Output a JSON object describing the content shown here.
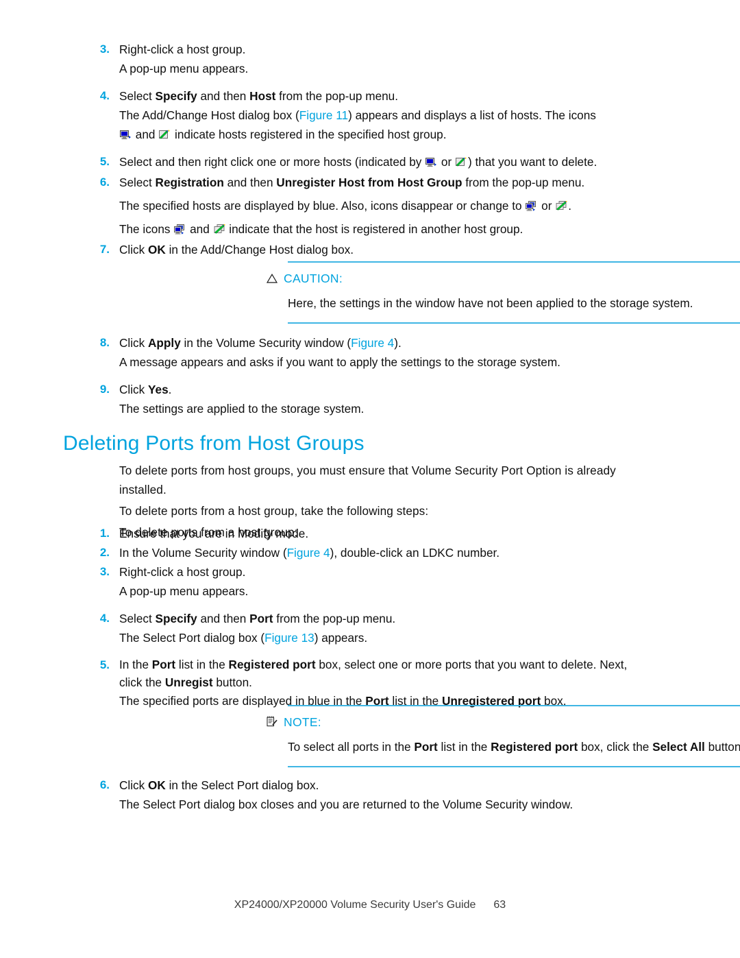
{
  "page": {
    "footer_title": "XP24000/XP20000 Volume Security User's Guide",
    "footer_page": "63"
  },
  "colors": {
    "accent_blue": "#00a3de",
    "rule_blue": "#3fb6e4",
    "body_text": "#101010"
  },
  "section_one": {
    "steps": [
      {
        "num": "3.",
        "line1_pre": "Right-click a host group.",
        "sub1": "A pop-up menu appears."
      },
      {
        "num": "4.",
        "line1_a": "Select ",
        "line1_b1": "Specify",
        "line1_c": " and then ",
        "line1_b2": "Host",
        "line1_d": " from the pop-up menu.",
        "sub1_a": "The Add/Change Host dialog box (",
        "sub1_fig": "Figure 11",
        "sub1_b": ") appears and displays a list of hosts. The icons",
        "sub2_a": " and ",
        "sub2_b": " indicate hosts registered in the specified host group."
      },
      {
        "num": "5.",
        "line1_a": "Select and then right click one or more hosts (indicated by ",
        "line1_b": " or ",
        "line1_c": ") that you want to delete."
      },
      {
        "num": "6.",
        "line1_a": "Select ",
        "line1_b1": "Registration",
        "line1_c": " and then ",
        "line1_b2": "Unregister Host from Host Group",
        "line1_d": " from the pop-up menu.",
        "sub1_a": "The specified hosts are displayed by blue. Also, icons disappear or change to ",
        "sub1_b": " or ",
        "sub1_c": ".",
        "sub2_a": "The icons ",
        "sub2_b": " and ",
        "sub2_c": " indicate that the host is registered in another host group."
      },
      {
        "num": "7.",
        "line1_a": "Click ",
        "line1_b": "OK",
        "line1_c": " in the Add/Change Host dialog box."
      }
    ],
    "caution": {
      "icon": "caution-triangle-icon",
      "label": "CAUTION:",
      "text": "Here, the settings in the window have not been applied to the storage system."
    },
    "steps_after": [
      {
        "num": "8.",
        "line1_a": "Click ",
        "line1_b": "Apply",
        "line1_c": " in the Volume Security window (",
        "line1_fig": "Figure 4",
        "line1_d": ").",
        "sub1": "A message appears and asks if you want to apply the settings to the storage system."
      },
      {
        "num": "9.",
        "line1_a": "Click ",
        "line1_b": "Yes",
        "line1_c": ".",
        "sub1": "The settings are applied to the storage system."
      }
    ]
  },
  "section_two": {
    "title": "Deleting Ports from Host Groups",
    "intro": [
      "To delete ports from host groups, you must ensure that Volume Security Port Option is already installed.",
      "To delete ports from a host group, take the following steps:",
      "To delete ports from a host group:"
    ],
    "steps": [
      {
        "num": "1.",
        "line1": "Ensure that you are in Modify mode."
      },
      {
        "num": "2.",
        "line1_a": "In the Volume Security window (",
        "line1_fig": "Figure 4",
        "line1_b": "), double-click an LDKC number."
      },
      {
        "num": "3.",
        "line1": "Right-click a host group.",
        "sub1": "A pop-up menu appears."
      },
      {
        "num": "4.",
        "line1_a": "Select ",
        "line1_b1": "Specify",
        "line1_c": " and then ",
        "line1_b2": "Port",
        "line1_d": " from the pop-up menu.",
        "sub1_a": "The Select Port dialog box (",
        "sub1_fig": "Figure 13",
        "sub1_b": ") appears."
      },
      {
        "num": "5.",
        "line1_a": "In the ",
        "line1_b1": "Port",
        "line1_c": " list in the ",
        "line1_b2": "Registered port",
        "line1_d": " box, select one or more ports that you want to delete. Next,",
        "line2_a": "click the ",
        "line2_b": "Unregist",
        "line2_c": " button.",
        "sub1_a": "The specified ports are displayed in blue in the ",
        "sub1_b1": "Port",
        "sub1_c": " list in the ",
        "sub1_b2": "Unregistered port",
        "sub1_d": " box."
      }
    ],
    "note": {
      "icon": "note-pad-icon",
      "label": "NOTE:",
      "text_a": "To select all ports in the ",
      "text_b1": "Port",
      "text_c": " list in the ",
      "text_b2": "Registered port",
      "text_d": " box, click the ",
      "text_b3": "Select All",
      "text_e": " button."
    },
    "steps_after": [
      {
        "num": "6.",
        "line1_a": "Click ",
        "line1_b": "OK",
        "line1_c": " in the Select Port dialog box.",
        "sub1": "The Select Port dialog box closes and you are returned to the Volume Security window."
      }
    ]
  }
}
